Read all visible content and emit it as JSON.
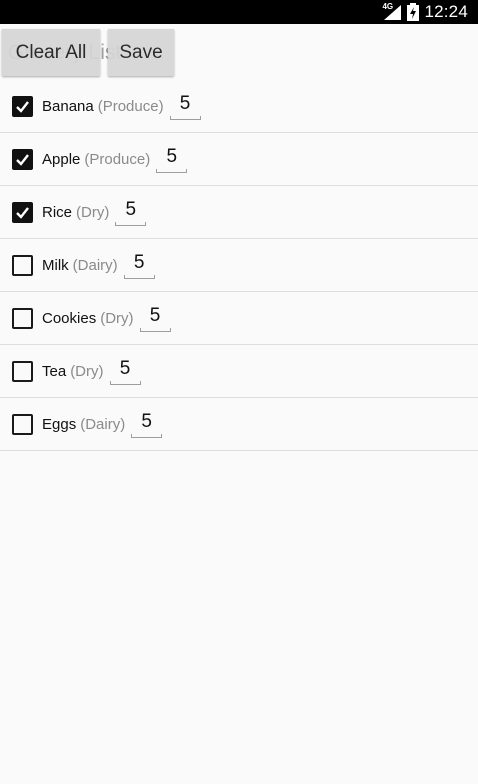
{
  "status_bar": {
    "network": "4G",
    "time": "12:24"
  },
  "header": {
    "title": "Grocery List",
    "clear_all_label": "Clear All",
    "save_label": "Save"
  },
  "items": [
    {
      "name": "Banana",
      "category": "(Produce)",
      "quantity": "5",
      "checked": true
    },
    {
      "name": "Apple",
      "category": "(Produce)",
      "quantity": "5",
      "checked": true
    },
    {
      "name": "Rice",
      "category": "(Dry)",
      "quantity": "5",
      "checked": true
    },
    {
      "name": "Milk",
      "category": "(Dairy)",
      "quantity": "5",
      "checked": false
    },
    {
      "name": "Cookies",
      "category": "(Dry)",
      "quantity": "5",
      "checked": false
    },
    {
      "name": "Tea",
      "category": "(Dry)",
      "quantity": "5",
      "checked": false
    },
    {
      "name": "Eggs",
      "category": "(Dairy)",
      "quantity": "5",
      "checked": false
    }
  ]
}
